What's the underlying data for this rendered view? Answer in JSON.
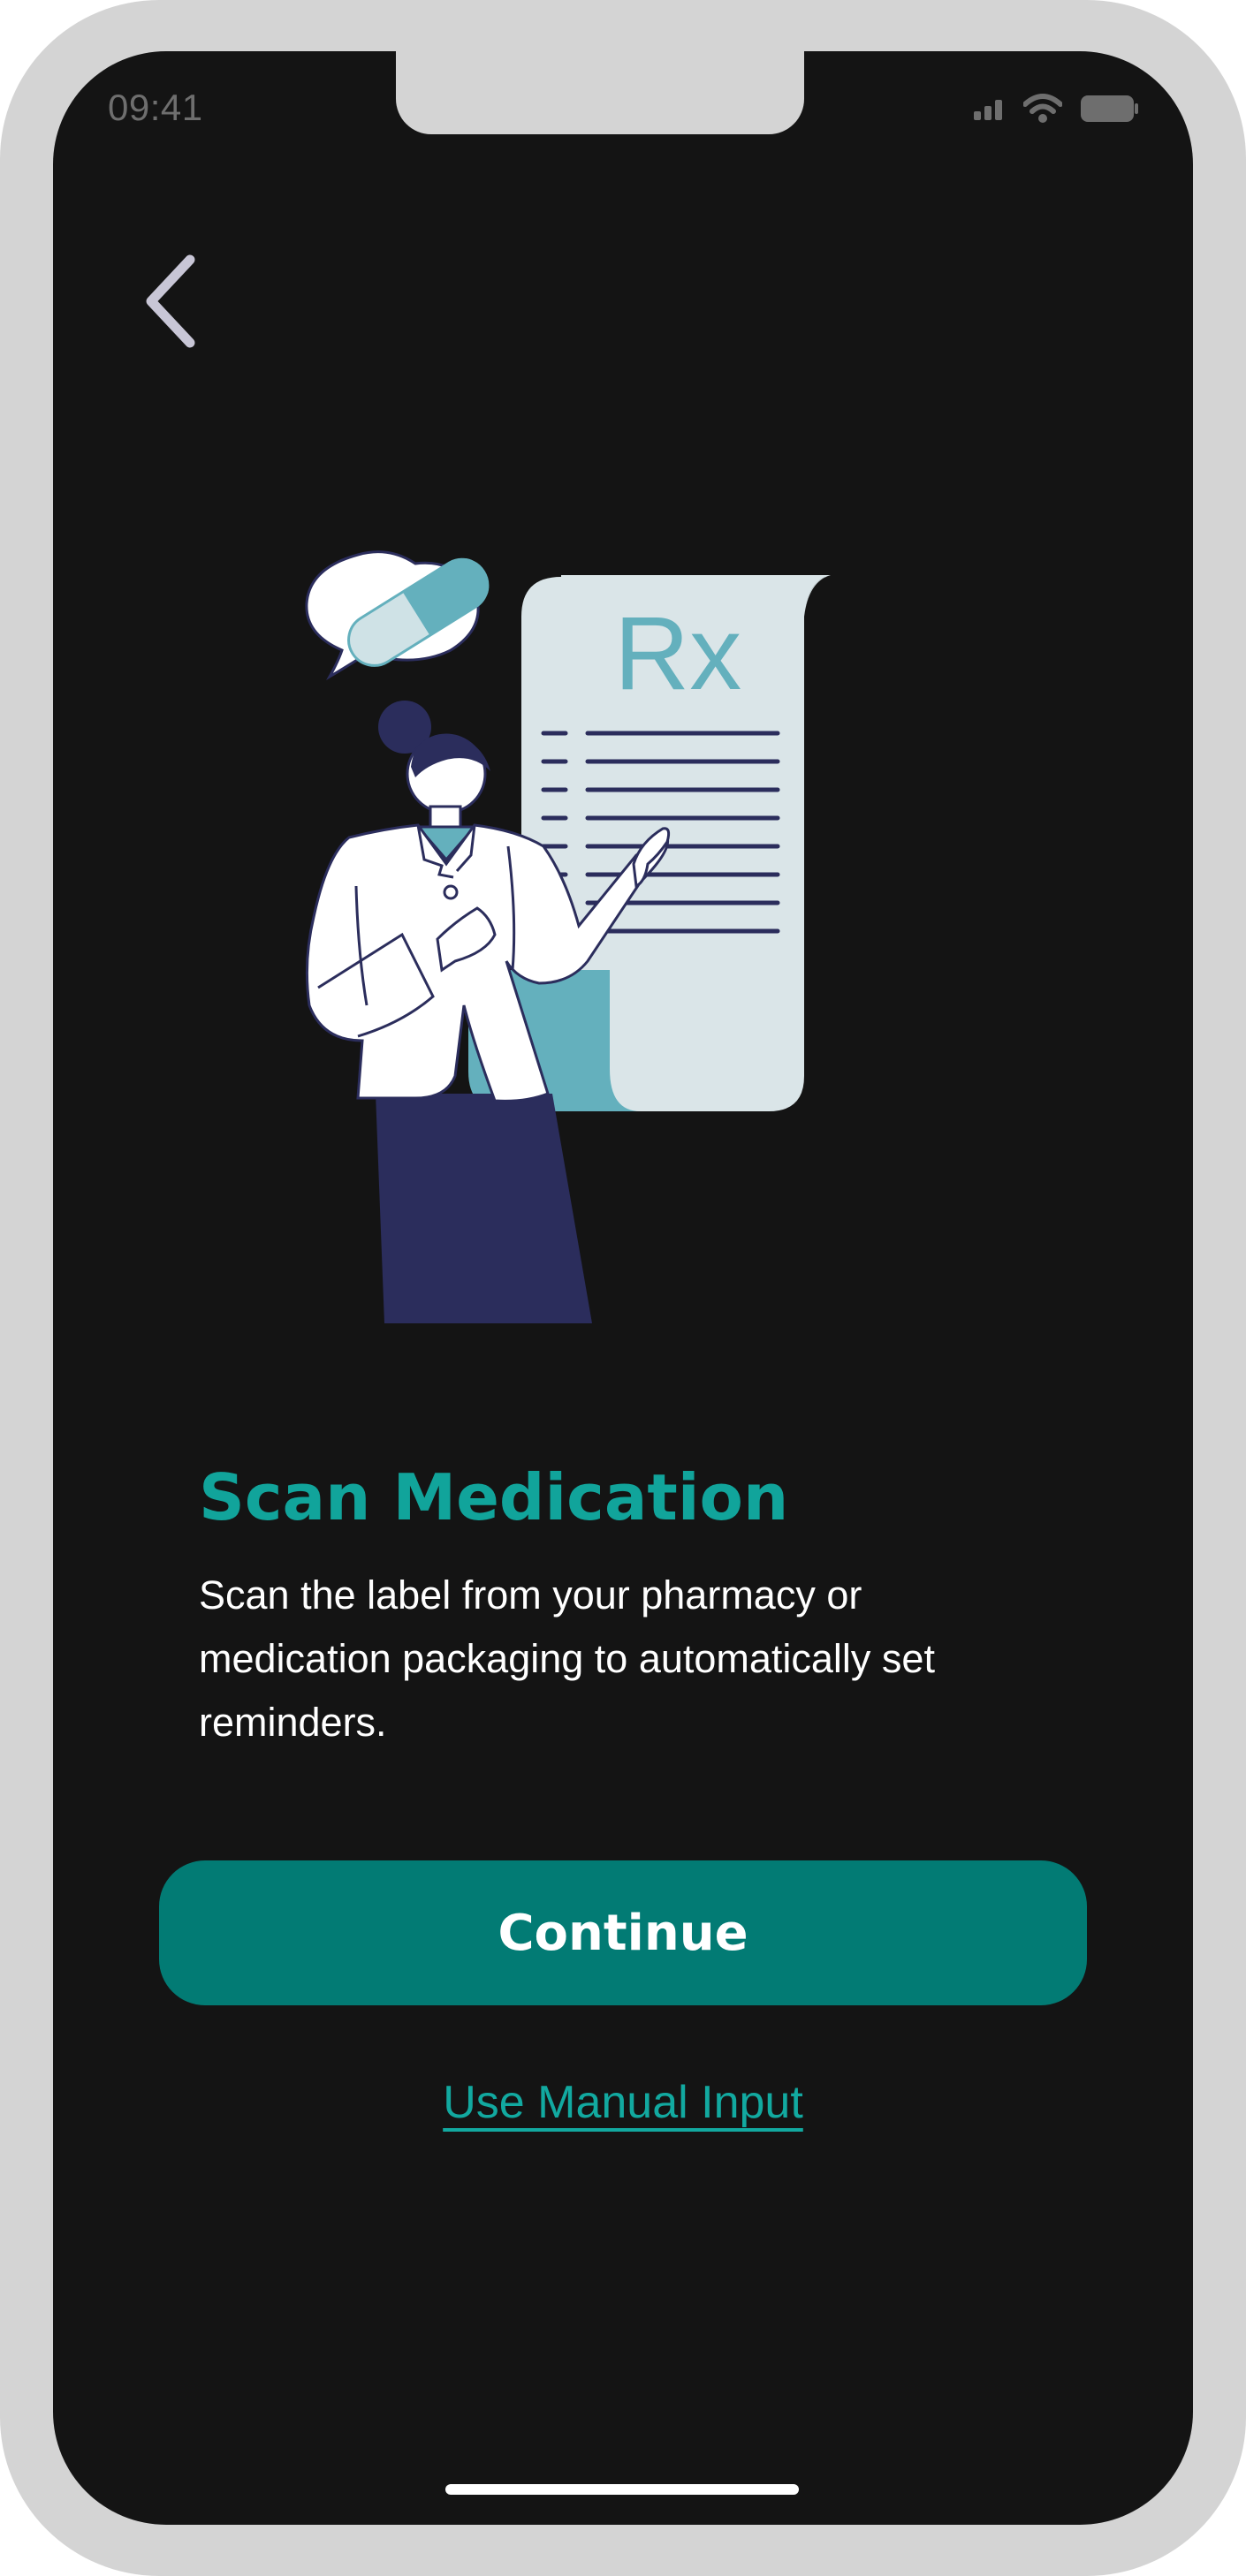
{
  "status_bar": {
    "time": "09:41",
    "icons": [
      "cellular-signal-icon",
      "wifi-icon",
      "battery-icon"
    ]
  },
  "nav": {
    "back_icon": "chevron-left-icon"
  },
  "illustration": {
    "rx_symbol": "Rx"
  },
  "content": {
    "title": "Scan Medication",
    "description": "Scan the label from your pharmacy or medication packaging to automatically set reminders."
  },
  "actions": {
    "continue_label": "Continue",
    "manual_input_label": "Use Manual Input"
  },
  "colors": {
    "background": "#141414",
    "accent": "#11a49b",
    "button": "#027b74",
    "illustration_teal": "#64b0bd",
    "illustration_navy": "#2b2d5c"
  }
}
